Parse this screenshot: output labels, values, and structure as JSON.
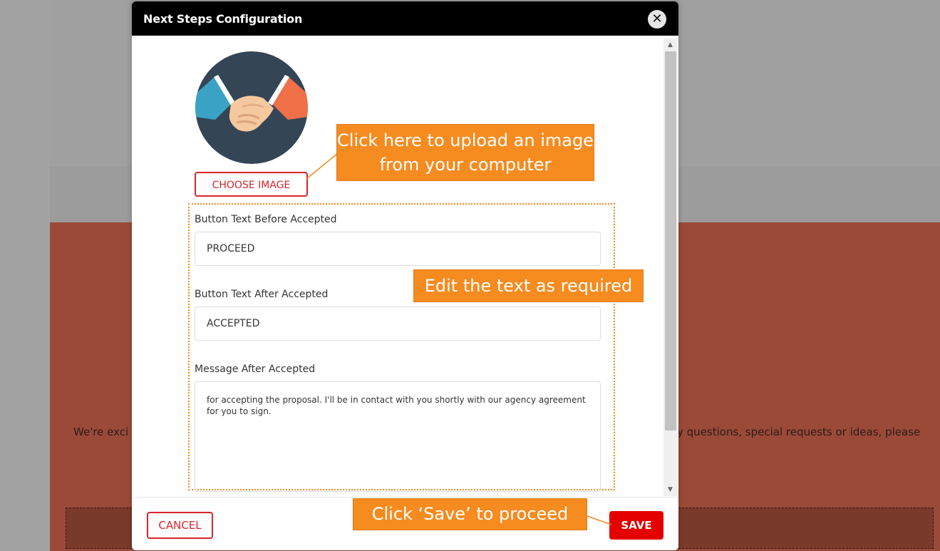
{
  "background": {
    "text_left": "We're exci",
    "text_right": "y questions, special requests or ideas, please"
  },
  "modal": {
    "title": "Next Steps Configuration",
    "close_glyph": "✕",
    "choose_image_label": "CHOOSE IMAGE",
    "fields": {
      "before_label": "Button Text Before Accepted",
      "before_value": "PROCEED",
      "after_label": "Button Text After Accepted",
      "after_value": "ACCEPTED",
      "message_label": "Message After Accepted",
      "message_value": "for accepting the proposal. I'll be in contact with you shortly with our agency agreement for you to sign."
    },
    "footer": {
      "cancel_label": "CANCEL",
      "save_label": "SAVE"
    },
    "scroll_up_glyph": "▲",
    "scroll_down_glyph": "▼"
  },
  "callouts": {
    "upload": "Click here to upload an image from your computer",
    "edit": "Edit the text as required",
    "save": "Click ‘Save’ to proceed"
  },
  "colors": {
    "accent_red": "#d9242c",
    "save_red": "#e40000",
    "callout_orange": "#f68b1f",
    "header_black": "#000000"
  },
  "icons": {
    "avatar": "handshake-icon",
    "close": "close-icon"
  }
}
